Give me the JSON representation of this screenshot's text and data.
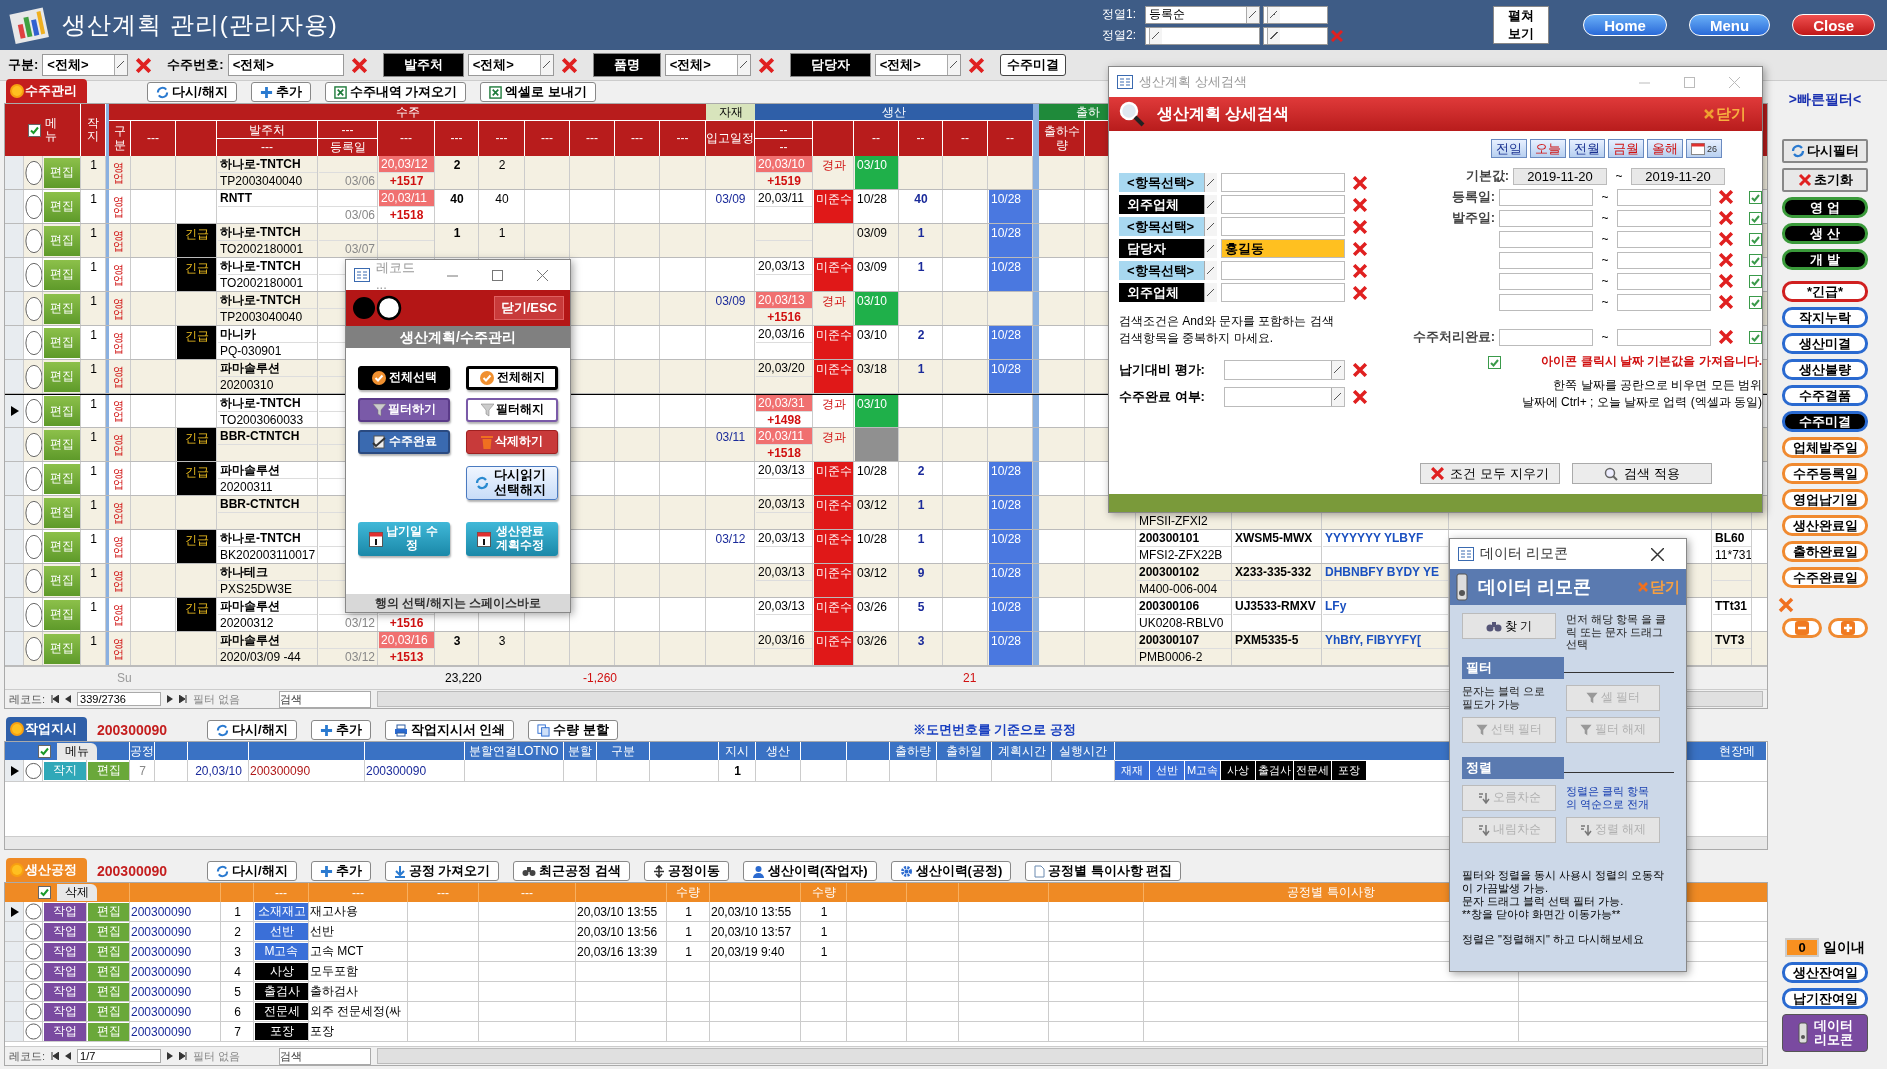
{
  "header": {
    "title": "생산계획 관리(관리자용)",
    "sort1_label": "정열1:",
    "sort1_value": "등록순",
    "sort2_label": "정열2:",
    "expand_button": [
      "펼쳐",
      "보기"
    ],
    "nav_buttons": [
      {
        "label": "Home",
        "kind": "blue"
      },
      {
        "label": "Menu",
        "kind": "blue"
      },
      {
        "label": "Close",
        "kind": "red"
      }
    ]
  },
  "filter_bar": {
    "items": [
      {
        "kind": "plain",
        "label": "구분:",
        "value": "<전체>",
        "dropdown": true
      },
      {
        "kind": "plain",
        "label": "수주번호:",
        "value": "<전체>",
        "dropdown": false
      },
      {
        "kind": "black",
        "label": "발주처",
        "value": "<전체>",
        "dropdown": true
      },
      {
        "kind": "black",
        "label": "품명",
        "value": "<전체>",
        "dropdown": true
      },
      {
        "kind": "black",
        "label": "담당자",
        "value": "<전체>",
        "dropdown": true
      }
    ],
    "button": "수주미결"
  },
  "orders": {
    "tab": "수주관리",
    "buttons": [
      "다시/해지",
      "추가",
      "수주내역 가져오기",
      "엑셀로 보내기"
    ],
    "header": {
      "menu": "메뉴",
      "jakji": "작지",
      "groups": [
        {
          "title": "수주",
          "color": "#b81c1c",
          "cells": [
            {
              "label": "구분"
            },
            {
              "label": "---"
            },
            {},
            {
              "label": "발주처",
              "sub": "---"
            },
            {
              "label": "---",
              "sub": "등록일"
            },
            {
              "label": "---"
            },
            {
              "label": "---"
            },
            {
              "label": "---"
            },
            {
              "label": "---"
            },
            {
              "label": "---"
            },
            {
              "label": "---"
            },
            {
              "label": "---"
            }
          ]
        },
        {
          "title": "자재",
          "color": "#d8e4bc",
          "cells": [
            {
              "label": "입고일정"
            }
          ]
        },
        {
          "title": "생산",
          "color": "#2f5fa8",
          "cells": [
            {
              "label": "--",
              "sub": "--"
            },
            {},
            {
              "label": "--"
            },
            {
              "label": "--"
            },
            {
              "label": "--"
            },
            {
              "label": "--"
            }
          ]
        },
        {
          "title": "출하",
          "color": "#1f8a3a",
          "cells": [
            {
              "label": "출하수량"
            },
            {}
          ]
        }
      ]
    },
    "rows": [
      {
        "selected": false,
        "edit": "편집",
        "jakji": "1",
        "gubun": "영업",
        "client": "하나로-TNTCH",
        "code": "TP2003040040",
        "reg": "03/06",
        "due": "20,03/12",
        "due_alert": true,
        "diff": "+1517",
        "q1": "2",
        "q2": "2",
        "prod": "20,03/10",
        "prod_alert": true,
        "prod_diff": "+1519",
        "status": "경과",
        "overdue": false,
        "done": "03/10",
        "done_green": true
      },
      {
        "selected": false,
        "edit": "편집",
        "jakji": "1",
        "gubun": "영업",
        "client": "RNTT",
        "reg": "03/06",
        "due": "20,03/11",
        "due_alert": true,
        "diff": "+1518",
        "q1": "40",
        "q2": "40",
        "in_date": "03/09",
        "prod": "20,03/11",
        "prod_alert": false,
        "status": "미준수",
        "overdue": true,
        "done": "10/28",
        "done_green": false,
        "qty": "40",
        "ship": "10/28"
      },
      {
        "selected": false,
        "edit": "편집",
        "jakji": "1",
        "gubun": "영업",
        "tag": "긴급",
        "client": "하나로-TNTCH",
        "code": "TO2002180001",
        "reg": "03/07",
        "q1": "1",
        "q2": "1",
        "done": "03/09",
        "done_green": false,
        "qty": "1",
        "ship": "10/28"
      },
      {
        "selected": false,
        "edit": "편집",
        "jakji": "1",
        "gubun": "영업",
        "tag": "긴급",
        "client": "하나로-TNTCH",
        "code": "TO2002180001",
        "prod": "20,03/13",
        "prod_alert": false,
        "status": "미준수",
        "overdue": true,
        "done": "03/09",
        "done_green": false,
        "qty": "1",
        "ship": "10/28"
      },
      {
        "selected": false,
        "edit": "편집",
        "jakji": "1",
        "gubun": "영업",
        "client": "하나로-TNTCH",
        "code": "TP2003040040",
        "in_date": "03/09",
        "prod": "20,03/13",
        "prod_alert": true,
        "prod_diff": "+1516",
        "status": "경과",
        "overdue": false,
        "done": "03/10",
        "done_green": true
      },
      {
        "selected": false,
        "edit": "편집",
        "jakji": "1",
        "gubun": "영업",
        "tag": "긴급",
        "client": "마니카",
        "code": "PQ-030901",
        "prod": "20,03/16",
        "prod_alert": false,
        "status": "미준수",
        "overdue": true,
        "done": "03/10",
        "done_green": false,
        "qty": "2",
        "ship": "10/28"
      },
      {
        "selected": false,
        "edit": "편집",
        "jakji": "1",
        "gubun": "영업",
        "client": "파마솔루션",
        "code": "20200310",
        "prod": "20,03/20",
        "prod_alert": false,
        "status": "미준수",
        "overdue": true,
        "done": "03/18",
        "done_green": false,
        "qty": "1",
        "ship": "10/28"
      },
      {
        "selected": true,
        "edit": "편집",
        "jakji": "1",
        "gubun": "영업",
        "client": "하나로-TNTCH",
        "code": "TO2003060033",
        "prod": "20,03/31",
        "prod_alert": true,
        "prod_diff": "+1498",
        "status": "경과",
        "overdue": false,
        "done": "03/10",
        "done_green": true
      },
      {
        "selected": false,
        "edit": "편집",
        "jakji": "1",
        "gubun": "영업",
        "tag": "긴급",
        "client": "BBR-CTNTCH",
        "in_date": "03/11",
        "prod": "20,03/11",
        "prod_alert": true,
        "prod_diff": "+1518",
        "status": "경과",
        "overdue": false,
        "done_green": false,
        "done_gray": true
      },
      {
        "selected": false,
        "edit": "편집",
        "jakji": "1",
        "gubun": "영업",
        "tag": "긴급",
        "client": "파마솔루션",
        "code": "20200311",
        "prod": "20,03/13",
        "prod_alert": false,
        "status": "미준수",
        "overdue": true,
        "done": "10/28",
        "done_green": false,
        "qty": "2",
        "ship": "10/28"
      },
      {
        "selected": false,
        "edit": "편집",
        "jakji": "1",
        "gubun": "영업",
        "client": "BBR-CTNTCH",
        "prod": "20,03/13",
        "prod_alert": false,
        "status": "미준수",
        "overdue": true,
        "done": "03/12",
        "done_green": false,
        "qty": "1",
        "ship": "10/28",
        "x_code2": "MFSII-ZFXI2"
      },
      {
        "selected": false,
        "edit": "편집",
        "jakji": "1",
        "gubun": "영업",
        "tag": "긴급",
        "client": "하나로-TNTCH",
        "code": "BK202003110017",
        "in_date": "03/12",
        "prod": "20,03/13",
        "prod_alert": false,
        "status": "미준수",
        "overdue": true,
        "done": "10/28",
        "done_green": false,
        "qty": "1",
        "ship": "10/28",
        "x_code": "200300101",
        "x_drawing": "XWSM5-MWX",
        "x_name": "YYYYYYY YLBYF",
        "x_note": "BL60",
        "x_code2": "MFSI2-ZFX22B",
        "x_note2": "11*731"
      },
      {
        "selected": false,
        "edit": "편집",
        "jakji": "1",
        "gubun": "영업",
        "client": "하나테크",
        "code": "PXS25DW3E",
        "prod": "20,03/13",
        "prod_alert": false,
        "status": "미준수",
        "overdue": true,
        "done": "03/12",
        "done_green": false,
        "qty": "9",
        "ship": "10/28",
        "x_code": "200300102",
        "x_drawing": "X233-335-332",
        "x_name": "DHBNBFY BYDY YE",
        "x_code2": "M400-006-004"
      },
      {
        "selected": false,
        "edit": "편집",
        "jakji": "1",
        "gubun": "영업",
        "tag": "긴급",
        "client": "파마솔루션",
        "code": "20200312",
        "reg": "03/12",
        "diff": "+1516",
        "prod": "20,03/13",
        "prod_alert": false,
        "status": "미준수",
        "overdue": true,
        "done": "03/26",
        "done_green": false,
        "qty": "5",
        "ship": "10/28",
        "x_code": "200300106",
        "x_drawing": "UJ3533-RMXV",
        "x_name": "LFy",
        "x_note": "TTt31",
        "x_code2": "UK0208-RBLV0"
      },
      {
        "selected": false,
        "edit": "편집",
        "jakji": "1",
        "gubun": "영업",
        "client": "파마솔루션",
        "code": "2020/03/09 -44",
        "reg": "03/12",
        "due": "20,03/16",
        "due_alert": true,
        "diff": "+1513",
        "q1": "3",
        "q2": "3",
        "prod": "20,03/16",
        "prod_alert": false,
        "status": "미준수",
        "overdue": true,
        "done": "03/26",
        "done_green": false,
        "qty": "3",
        "ship": "10/28",
        "x_code": "200300107",
        "x_drawing": "PXM5335-5",
        "x_name": "YhBfY, FIBYYFY[",
        "x_note": "TVT3",
        "x_code2": "PMB0006-2"
      }
    ],
    "sum": {
      "label": "Su",
      "q1": "23,220",
      "c5": "-1,260",
      "c8": "21"
    },
    "nav": {
      "label": "레코드:",
      "position": "339/2736",
      "filter": "필터 없음",
      "search": "검색"
    }
  },
  "work_orders": {
    "tab": "작업지시",
    "id": "200300090",
    "buttons": [
      "다시/해지",
      "추가",
      "작업지시서 인쇄",
      "수량 분할"
    ],
    "note": "※도면번호를 기준으로 공정",
    "columns": {
      "menu": "메뉴",
      "process": "공정",
      "lot": "분할연결LOTNO",
      "split": "분할",
      "gubun": "구분",
      "order": "지시",
      "prod": "생산",
      "ship_qty": "출하량",
      "ship_date": "출하일",
      "plan": "계획시간",
      "run": "실행시간",
      "memo": "현장메"
    },
    "rows": [
      {
        "selected": true,
        "kind_button": "작지",
        "edit": "편집",
        "process": "7",
        "date": "20,03/10",
        "id": "200300090",
        "lot_id": "200300090",
        "order": "1",
        "chips": [
          {
            "label": "재재",
            "color": "#3a6fd8"
          },
          {
            "label": "선반",
            "color": "#3a6fd8"
          },
          {
            "label": "M고속",
            "color": "#3a6fd8"
          },
          {
            "label": "사상",
            "color": "#000000"
          },
          {
            "label": "출검사",
            "color": "#000000"
          },
          {
            "label": "전문세",
            "color": "#000000"
          },
          {
            "label": "포장",
            "color": "#000000"
          }
        ]
      }
    ]
  },
  "processes": {
    "tab": "생산공정",
    "id": "200300090",
    "buttons": [
      "다시/해지",
      "추가",
      "공정 가져오기",
      "최근공정 검색",
      "공정이동",
      "생산이력(작업자)",
      "생산이력(공정)",
      "공정별 특이사항 편집"
    ],
    "columns": {
      "delete": "삭제",
      "dashes": [
        "---",
        "---",
        "---",
        "---"
      ],
      "qty1": "수량",
      "qty2": "수량",
      "note": "공정별 특이사항"
    },
    "rows": [
      {
        "selected": true,
        "work": "작업",
        "edit": "편집",
        "id": "200300090",
        "no": "1",
        "chip": "소재재고",
        "color": "#3a6fd8",
        "desc": "재고사용",
        "start": "20,03/10 13:55",
        "q1": "1",
        "end": "20,03/10 13:55",
        "q2": "1"
      },
      {
        "selected": false,
        "work": "작업",
        "edit": "편집",
        "id": "200300090",
        "no": "2",
        "chip": "선반",
        "color": "#3a6fd8",
        "desc": "선반",
        "start": "20,03/10 13:56",
        "q1": "1",
        "end": "20,03/10 13:57",
        "q2": "1"
      },
      {
        "selected": false,
        "work": "작업",
        "edit": "편집",
        "id": "200300090",
        "no": "3",
        "chip": "M고속",
        "color": "#3a6fd8",
        "desc": "고속 MCT",
        "start": "20,03/16 13:39",
        "q1": "1",
        "end": "20,03/19 9:40",
        "q2": "1"
      },
      {
        "selected": false,
        "work": "작업",
        "edit": "편집",
        "id": "200300090",
        "no": "4",
        "chip": "사상",
        "color": "#000000",
        "desc": "모두포함"
      },
      {
        "selected": false,
        "work": "작업",
        "edit": "편집",
        "id": "200300090",
        "no": "5",
        "chip": "출검사",
        "color": "#000000",
        "desc": "출하검사"
      },
      {
        "selected": false,
        "work": "작업",
        "edit": "편집",
        "id": "200300090",
        "no": "6",
        "chip": "전문세",
        "color": "#000000",
        "desc": "외주 전문세정(싸"
      },
      {
        "selected": false,
        "work": "작업",
        "edit": "편집",
        "id": "200300090",
        "no": "7",
        "chip": "포장",
        "color": "#000000",
        "desc": "포장"
      }
    ],
    "nav": {
      "label": "레코드:",
      "position": "1/7",
      "filter": "필터 없음",
      "search": "검색"
    }
  },
  "quick_filter": {
    "title": ">빠른필터<",
    "items": [
      {
        "label": "다시필터",
        "kind": "tool",
        "selected": false
      },
      {
        "label": "초기화",
        "kind": "tool",
        "selected": false
      },
      {
        "label": "영 업",
        "kind": "dept",
        "selected": true
      },
      {
        "label": "생 산",
        "kind": "dept",
        "selected": true
      },
      {
        "label": "개 발",
        "kind": "dept",
        "selected": true
      },
      {
        "label": "*긴급*",
        "kind": "urgent",
        "selected": false
      },
      {
        "label": "작지누락",
        "kind": "status",
        "selected": false
      },
      {
        "label": "생산미결",
        "kind": "status",
        "selected": false
      },
      {
        "label": "생산불량",
        "kind": "status",
        "selected": false
      },
      {
        "label": "수주결품",
        "kind": "status",
        "selected": false
      },
      {
        "label": "수주미결",
        "kind": "status",
        "selected": true
      },
      {
        "label": "업체발주일",
        "kind": "date",
        "selected": false
      },
      {
        "label": "수주등록일",
        "kind": "date",
        "selected": false
      },
      {
        "label": "영업납기일",
        "kind": "date",
        "selected": false
      },
      {
        "label": "생산완료일",
        "kind": "date",
        "selected": false
      },
      {
        "label": "출하완료일",
        "kind": "date",
        "selected": false
      },
      {
        "label": "수주완료일",
        "kind": "date",
        "selected": false
      }
    ],
    "days_value": "0",
    "days_label": "일이내",
    "remain_buttons": [
      "생산잔여일",
      "납기잔여일"
    ],
    "remote_button": [
      "데이터",
      "리모콘"
    ]
  },
  "search_dialog": {
    "window_title": "생산계획 상세검색",
    "heading": "생산계획 상세검색",
    "close": "닫기",
    "quick_dates": [
      "전일",
      "오늘",
      "전월",
      "금월",
      "올해"
    ],
    "calendar_label": "26",
    "fields": [
      {
        "label": "<항목선택>",
        "kind": "select"
      },
      {
        "label": "외주업체",
        "kind": "black"
      },
      {
        "label": "<항목선택>",
        "kind": "select"
      },
      {
        "label": "담당자",
        "kind": "black",
        "value": "홍길동"
      },
      {
        "label": "<항목선택>",
        "kind": "select"
      },
      {
        "label": "외주업체",
        "kind": "black"
      }
    ],
    "note": [
      "검색조건은 And와 문자를 포함하는 검색",
      "검색항목을 중복하지 마세요."
    ],
    "selects": [
      {
        "label": "납기대비 평가:"
      },
      {
        "label": "수주완료 여부:"
      }
    ],
    "default_range": {
      "label": "기본값:",
      "from": "2019-11-20",
      "to": "2019-11-20"
    },
    "range_labels": [
      "등록일:",
      "발주일:"
    ],
    "done_range_label": "수주처리완료:",
    "tilde": "~",
    "icon_note": "아이콘 클릭시 날짜 기본값을 가져옵니다.",
    "help": [
      "한쪽 날짜를 공란으로 비우면 모든 범위",
      "날짜에 Ctrl+ ; 오늘 날짜로 업력 (엑셀과 동일)"
    ],
    "buttons": [
      "조건 모두 지우기",
      "검색 적용"
    ]
  },
  "record_popup": {
    "window_title": "레코드 ...",
    "close": "닫기/ESC",
    "heading": "생산계획/수주관리",
    "buttons": [
      {
        "label": "전체선택",
        "kind": "black"
      },
      {
        "label": "전체해지",
        "kind": "white"
      },
      {
        "label": "필터하기",
        "kind": "purple"
      },
      {
        "label": "필터해지",
        "kind": "purplewhite"
      },
      {
        "label": "수주완료",
        "kind": "blue"
      },
      {
        "label": "삭제하기",
        "kind": "red"
      },
      {
        "label": "다시읽기 선택해지",
        "kind": "light"
      },
      {
        "label": "납기일 수정",
        "kind": "teal"
      },
      {
        "label": "생산완료 계획수정",
        "kind": "teal"
      }
    ],
    "footer": "행의 선택/해지는 스페이스바로"
  },
  "remote": {
    "window_title": "데이터 리모콘",
    "heading": "데이터 리모콘",
    "close": "닫기",
    "find": {
      "label": "찾 기",
      "disabled": false
    },
    "find_note": "먼저 해당 항목 을 클릭 또는 문자 드래그 선택",
    "filter_title": "필터",
    "filter_note": "문자는 블럭 으로 필도가 가능",
    "filter_buttons": [
      {
        "label": "셀 필터",
        "disabled": true
      },
      {
        "label": "선택 필터",
        "disabled": true
      },
      {
        "label": "필터 해제",
        "disabled": true
      }
    ],
    "sort_title": "정렬",
    "sort_note": "정렬은 클릭 항목 의 역순으로 전개",
    "sort_buttons": [
      {
        "label": "오름차순",
        "disabled": true
      },
      {
        "label": "내림차순",
        "disabled": true
      },
      {
        "label": "정렬 해제",
        "disabled": true
      }
    ],
    "notes": [
      "필터와 정렬을 동시 사용시 정렬의 오동작이 가끔발생 가능.",
      "문자 드래그 블럭 선택 필터 가능.",
      "**창을 닫아야 화면간 이동가능**"
    ],
    "last_note": "정렬은 \"정렬해지\" 하고 다시해보세요"
  }
}
